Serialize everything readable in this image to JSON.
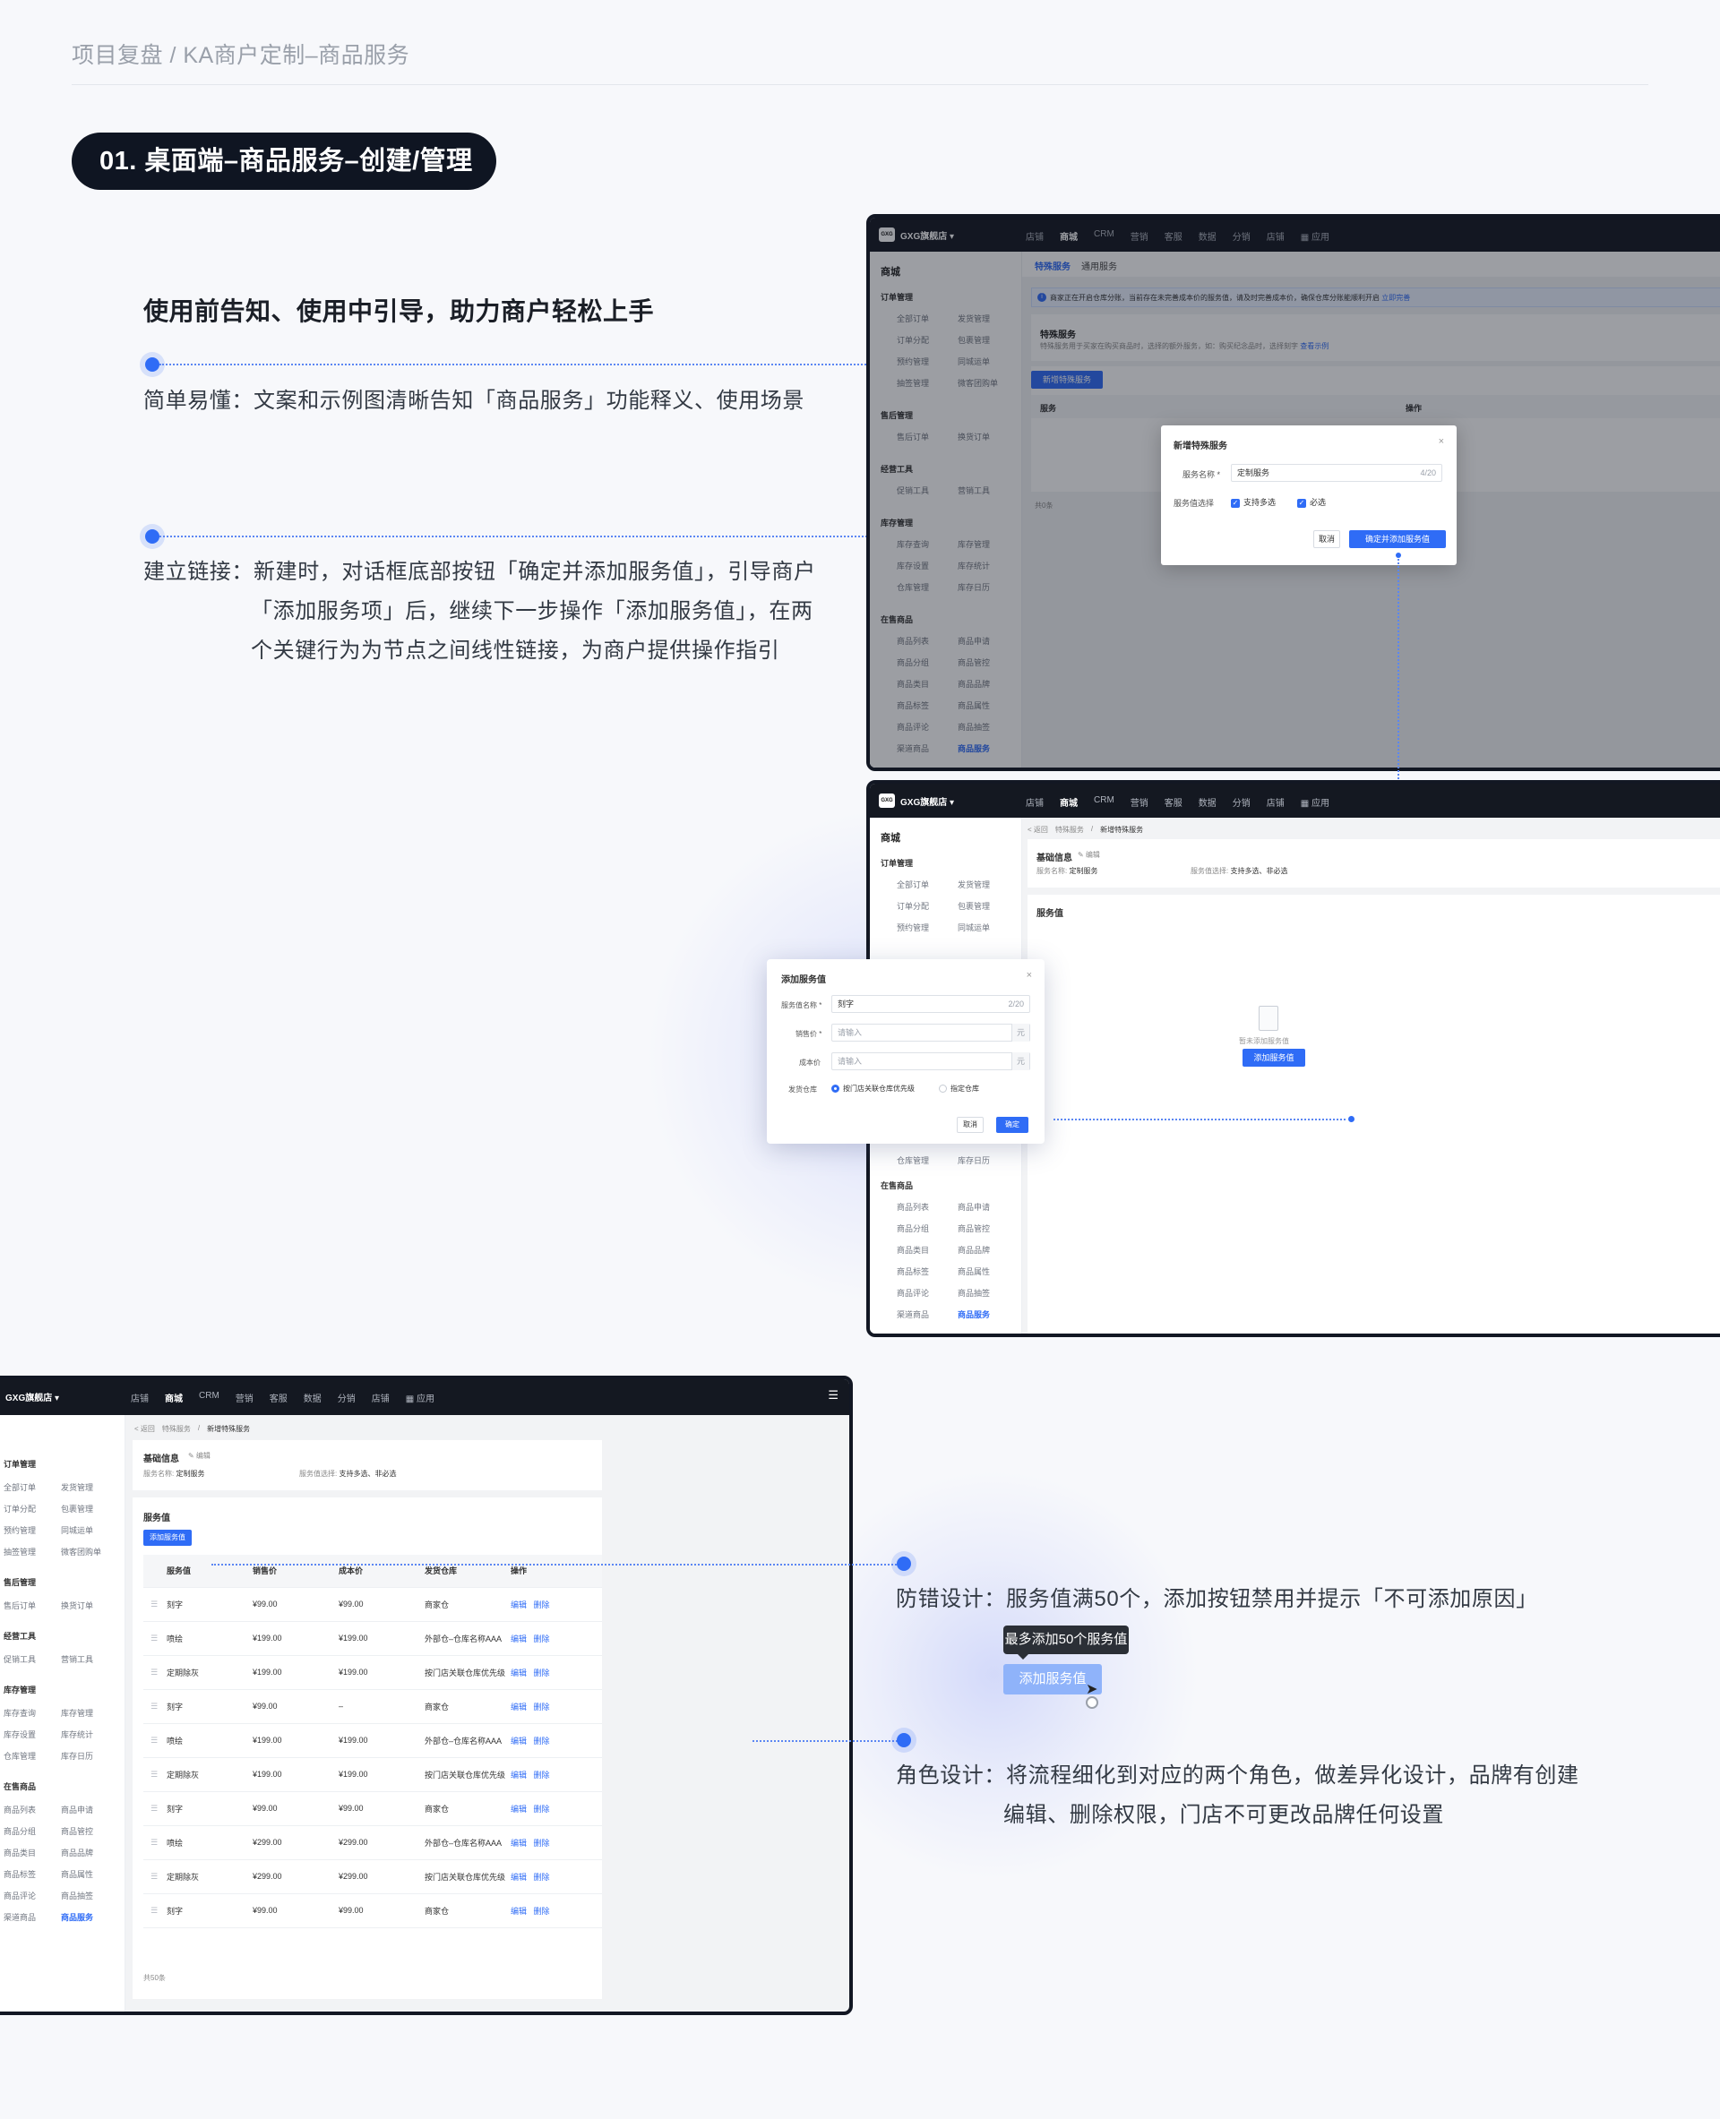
{
  "header": {
    "breadcrumb": "项目复盘 / KA商户定制–商品服务"
  },
  "section": {
    "title": "01.  桌面端–商品服务–创建/管理"
  },
  "intro": {
    "heading": "使用前告知、使用中引导，助力商户轻松上手",
    "p1": "简单易懂：文案和示例图清晰告知「商品服务」功能释义、使用场景",
    "p2_l1": "建立链接：新建时，对话框底部按钮「确定并添加服务值」，引导商户",
    "p2_l2": "「添加服务项」后，继续下一步操作「添加服务值」，在两",
    "p2_l3": "个关键行为为节点之间线性链接，为商户提供操作指引"
  },
  "right": {
    "p3": "防错设计：服务值满50个，添加按钮禁用并提示「不可添加原因」",
    "tooltip": "最多添加50个服务值",
    "disabled_btn": "添加服务值",
    "p4_l1": "角色设计：将流程细化到对应的两个角色，做差异化设计，品牌有创建",
    "p4_l2": "编辑、删除权限，门店不可更改品牌任何设置"
  },
  "app": {
    "logo": "GXG",
    "store": "GXG旗舰店 ▾",
    "nav": [
      "店铺",
      "商城",
      "CRM",
      "营销",
      "客服",
      "数据",
      "分销",
      "店铺"
    ],
    "apps": "▦ 应用",
    "sidebar_title": "商城",
    "groups": [
      "订单管理",
      "售后管理",
      "经营工具",
      "库存管理",
      "在售商品"
    ],
    "items": {
      "order": [
        "全部订单",
        "发货管理",
        "订单分配",
        "包裹管理",
        "预约管理",
        "同城运单",
        "抽签管理",
        "微客团购单"
      ],
      "after": [
        "售后订单",
        "换货订单"
      ],
      "tools": [
        "促销工具",
        "营销工具"
      ],
      "stock": [
        "库存查询",
        "库存管理",
        "库存设置",
        "库存统计",
        "仓库管理",
        "库存日历"
      ],
      "goods": [
        "商品列表",
        "商品申请",
        "商品分组",
        "商品管控",
        "商品类目",
        "商品品牌",
        "商品标签",
        "商品属性",
        "商品评论",
        "商品抽签",
        "渠道商品",
        "商品服务"
      ]
    }
  },
  "screen1": {
    "tab_active": "特殊服务",
    "tab_other": "通用服务",
    "notice": "商家正在开启仓库分账，当前存在未完善成本价的服务值，请及时完善成本价，确保仓库分账能顺利开启",
    "notice_link": "立即完善",
    "title": "特殊服务",
    "desc": "特殊服务用于买家在购买商品时，选择的额外服务，如：购买纪念品时，选择刻字",
    "desc_link": "查看示例",
    "new_btn": "新增特殊服务",
    "col_service": "服务",
    "col_op": "操作",
    "total": "共0条",
    "dialog": {
      "title": "新增特殊服务",
      "name_label": "服务名称 *",
      "name_value": "定制服务",
      "name_count": "4/20",
      "choose_label": "服务值选择",
      "opt1": "支持多选",
      "opt2": "必选",
      "cancel": "取消",
      "confirm": "确定并添加服务值"
    }
  },
  "screen2": {
    "crumbs": [
      "< 返回",
      "特殊服务",
      "/",
      "新增特殊服务"
    ],
    "basic_title": "基础信息",
    "edit": "✎ 编辑",
    "name_k": "服务名称:",
    "name_v": "定制服务",
    "choose_k": "服务值选择:",
    "choose_v": "支持多选、非必选",
    "values_title": "服务值",
    "empty": "暂未添加服务值",
    "add_btn": "添加服务值",
    "dialog": {
      "title": "添加服务值",
      "f1_label": "服务值名称 *",
      "f1_value": "刻字",
      "f1_count": "2/20",
      "f2_label": "销售价 *",
      "f3_label": "成本价",
      "placeholder": "请输入",
      "unit": "元",
      "f4_label": "发货仓库",
      "r1": "按门店关联仓库优先级",
      "r2": "指定仓库",
      "cancel": "取消",
      "ok": "确定"
    }
  },
  "screen3": {
    "crumbs": [
      "< 返回",
      "特殊服务",
      "/",
      "新增特殊服务"
    ],
    "basic_title": "基础信息",
    "edit": "✎ 编辑",
    "name_k": "服务名称:",
    "name_v": "定制服务",
    "choose_k": "服务值选择:",
    "choose_v": "支持多选、非必选",
    "values_title": "服务值",
    "add_btn": "添加服务值",
    "headers": [
      "服务值",
      "销售价",
      "成本价",
      "发货仓库",
      "操作"
    ],
    "rows": [
      [
        "刻字",
        "¥99.00",
        "¥99.00",
        "商家仓"
      ],
      [
        "喷绘",
        "¥199.00",
        "¥199.00",
        "外部仓–仓库名称AAA"
      ],
      [
        "定期除灰",
        "¥199.00",
        "¥199.00",
        "按门店关联仓库优先级"
      ],
      [
        "刻字",
        "¥99.00",
        "–",
        "商家仓"
      ],
      [
        "喷绘",
        "¥199.00",
        "¥199.00",
        "外部仓–仓库名称AAA"
      ],
      [
        "定期除灰",
        "¥199.00",
        "¥199.00",
        "按门店关联仓库优先级"
      ],
      [
        "刻字",
        "¥99.00",
        "¥99.00",
        "商家仓"
      ],
      [
        "喷绘",
        "¥299.00",
        "¥299.00",
        "外部仓–仓库名称AAA"
      ],
      [
        "定期除灰",
        "¥299.00",
        "¥299.00",
        "按门店关联仓库优先级"
      ],
      [
        "刻字",
        "¥99.00",
        "¥99.00",
        "商家仓"
      ]
    ],
    "edit_link": "编辑",
    "del_link": "删除",
    "total": "共50条"
  }
}
